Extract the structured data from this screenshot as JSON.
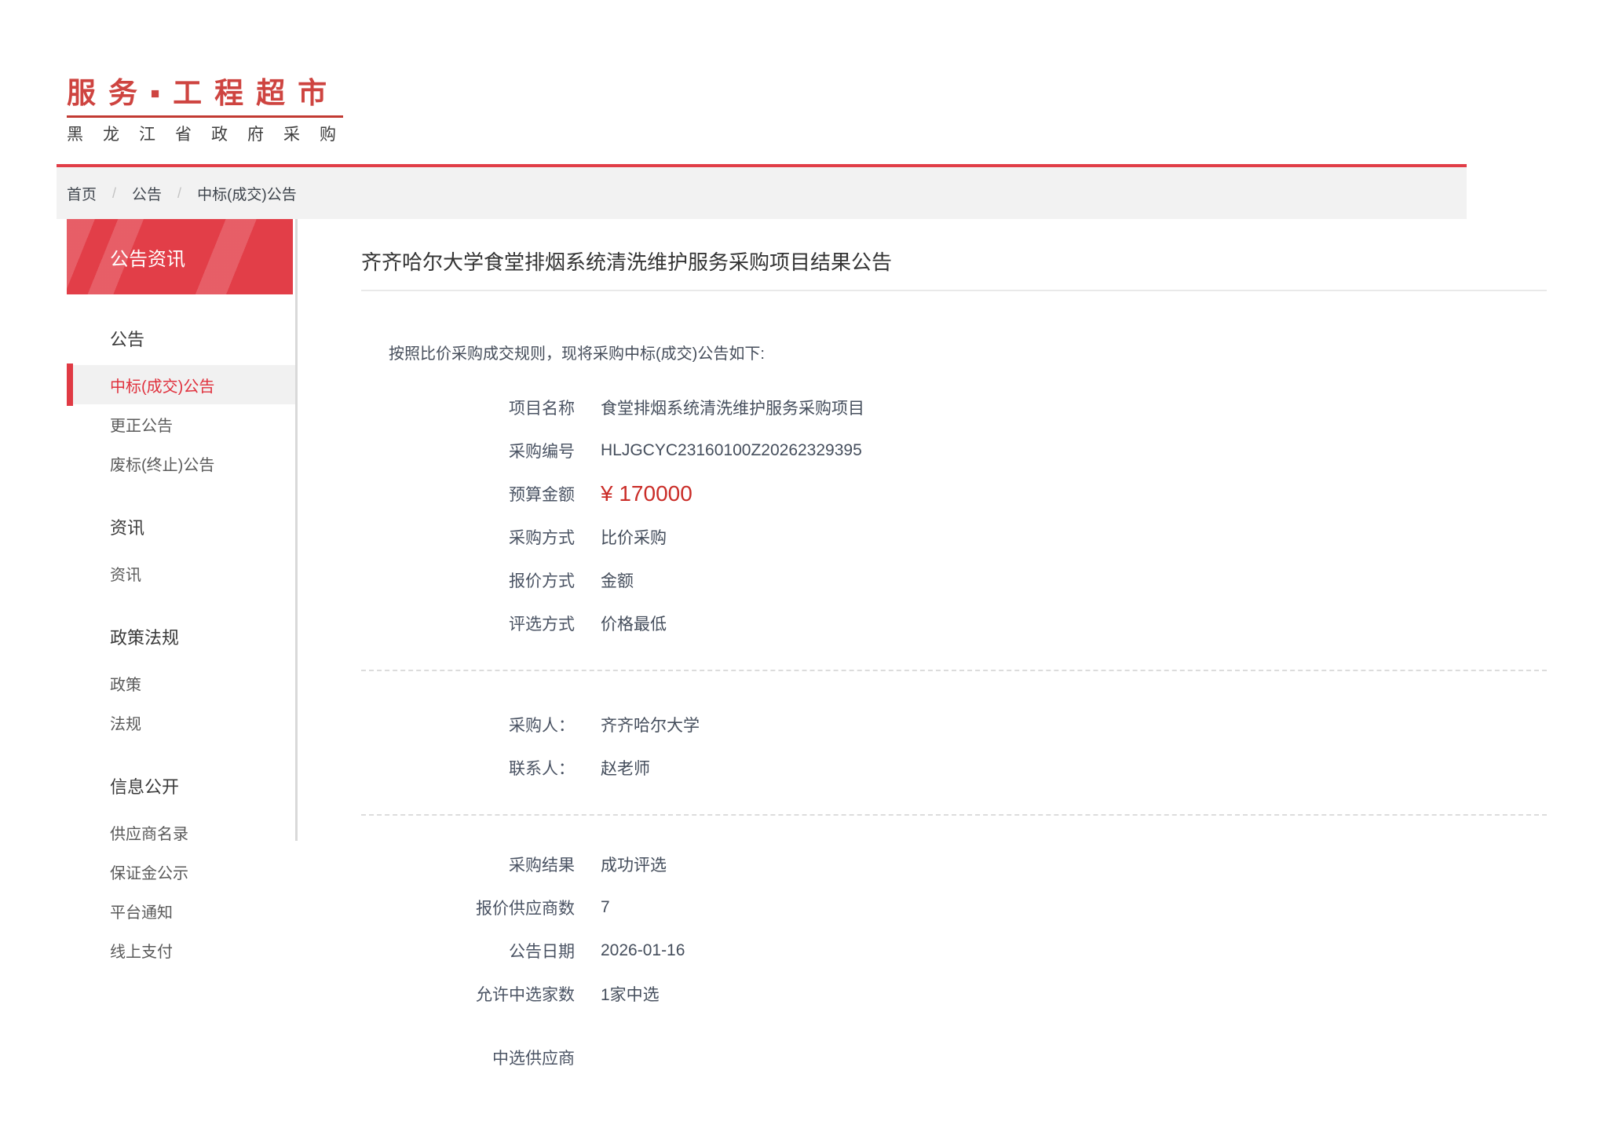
{
  "brand": {
    "logo_text": "服务▪工程超市",
    "tagline": "黑龙江省政府采购"
  },
  "breadcrumb": {
    "separator": "/",
    "items": [
      "首页",
      "公告",
      "中标(成交)公告"
    ]
  },
  "sidebar": {
    "panel_title": "公告资讯",
    "sections": [
      {
        "title": "公告",
        "items": [
          "中标(成交)公告",
          "更正公告",
          "废标(终止)公告"
        ]
      },
      {
        "title": "资讯",
        "items": [
          "资讯"
        ]
      },
      {
        "title": "政策法规",
        "items": [
          "政策",
          "法规"
        ]
      },
      {
        "title": "信息公开",
        "items": [
          "供应商名录",
          "保证金公示",
          "平台通知",
          "线上支付"
        ]
      }
    ],
    "active_item": "中标(成交)公告"
  },
  "main": {
    "title": "齐齐哈尔大学食堂排烟系统清洗维护服务采购项目结果公告",
    "intro": "按照比价采购成交规则，现将采购中标(成交)公告如下:",
    "project_fields": [
      {
        "label": "项目名称",
        "value": "食堂排烟系统清洗维护服务采购项目"
      },
      {
        "label": "采购编号",
        "value": "HLJGCYC23160100Z20262329395"
      },
      {
        "label": "预算金额",
        "value": "¥ 170000"
      },
      {
        "label": "采购方式",
        "value": "比价采购"
      },
      {
        "label": "报价方式",
        "value": "金额"
      },
      {
        "label": "评选方式",
        "value": "价格最低"
      }
    ],
    "contact_fields": [
      {
        "label": "采购人：",
        "value": "齐齐哈尔大学"
      },
      {
        "label": "联系人：",
        "value": "赵老师"
      }
    ],
    "result_fields": [
      {
        "label": "采购结果",
        "value": "成功评选"
      },
      {
        "label": "报价供应商数",
        "value": "7"
      },
      {
        "label": "公告日期",
        "value": "2026-01-16"
      },
      {
        "label": "允许中选家数",
        "value": "1家中选"
      },
      {
        "label": "中选供应商",
        "value": ""
      }
    ]
  },
  "colors": {
    "accent_red": "#e23e48",
    "logo_red": "#ce4440",
    "amount_red": "#ca2d28",
    "breadcrumb_bg": "#f2f2f2",
    "active_item_bg": "#f1f1f1"
  }
}
